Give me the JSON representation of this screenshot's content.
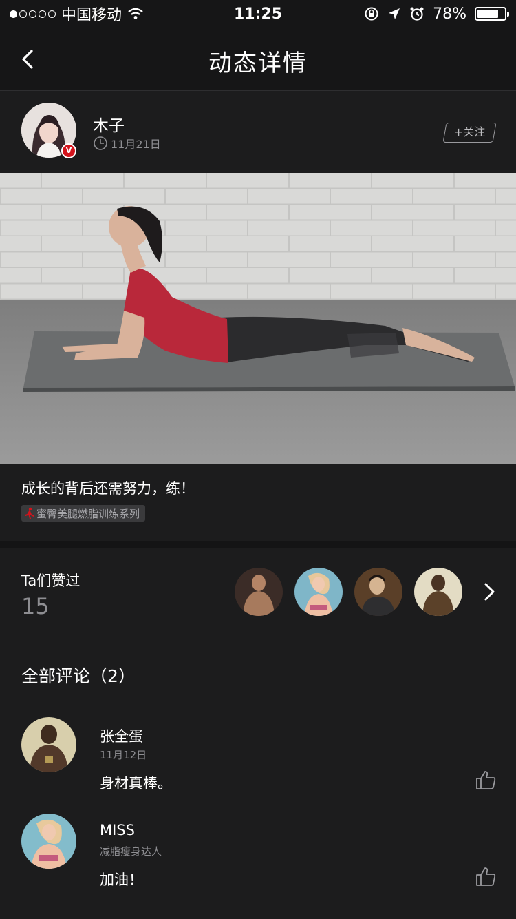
{
  "status_bar": {
    "carrier": "中国移动",
    "time": "11:25",
    "battery": "78%",
    "battery_level": 0.78
  },
  "nav": {
    "title": "动态详情"
  },
  "author": {
    "name": "木子",
    "date": "11月21日",
    "badge": "V",
    "follow_label": "+关注"
  },
  "post": {
    "caption": "成长的背后还需努力，练！",
    "tag": "蜜臀美腿燃脂训练系列"
  },
  "likes": {
    "label": "Ta们赞过",
    "count": "15"
  },
  "comments": {
    "header": "全部评论（2）",
    "items": [
      {
        "name": "张全蛋",
        "sub": "11月12日",
        "text": "身材真棒。"
      },
      {
        "name": "MISS",
        "sub": "减脂瘦身达人",
        "text": "加油！"
      }
    ]
  },
  "colors": {
    "background": "#1c1c1d",
    "badge_red": "#d3131c",
    "muted_text": "#8e8e92"
  }
}
